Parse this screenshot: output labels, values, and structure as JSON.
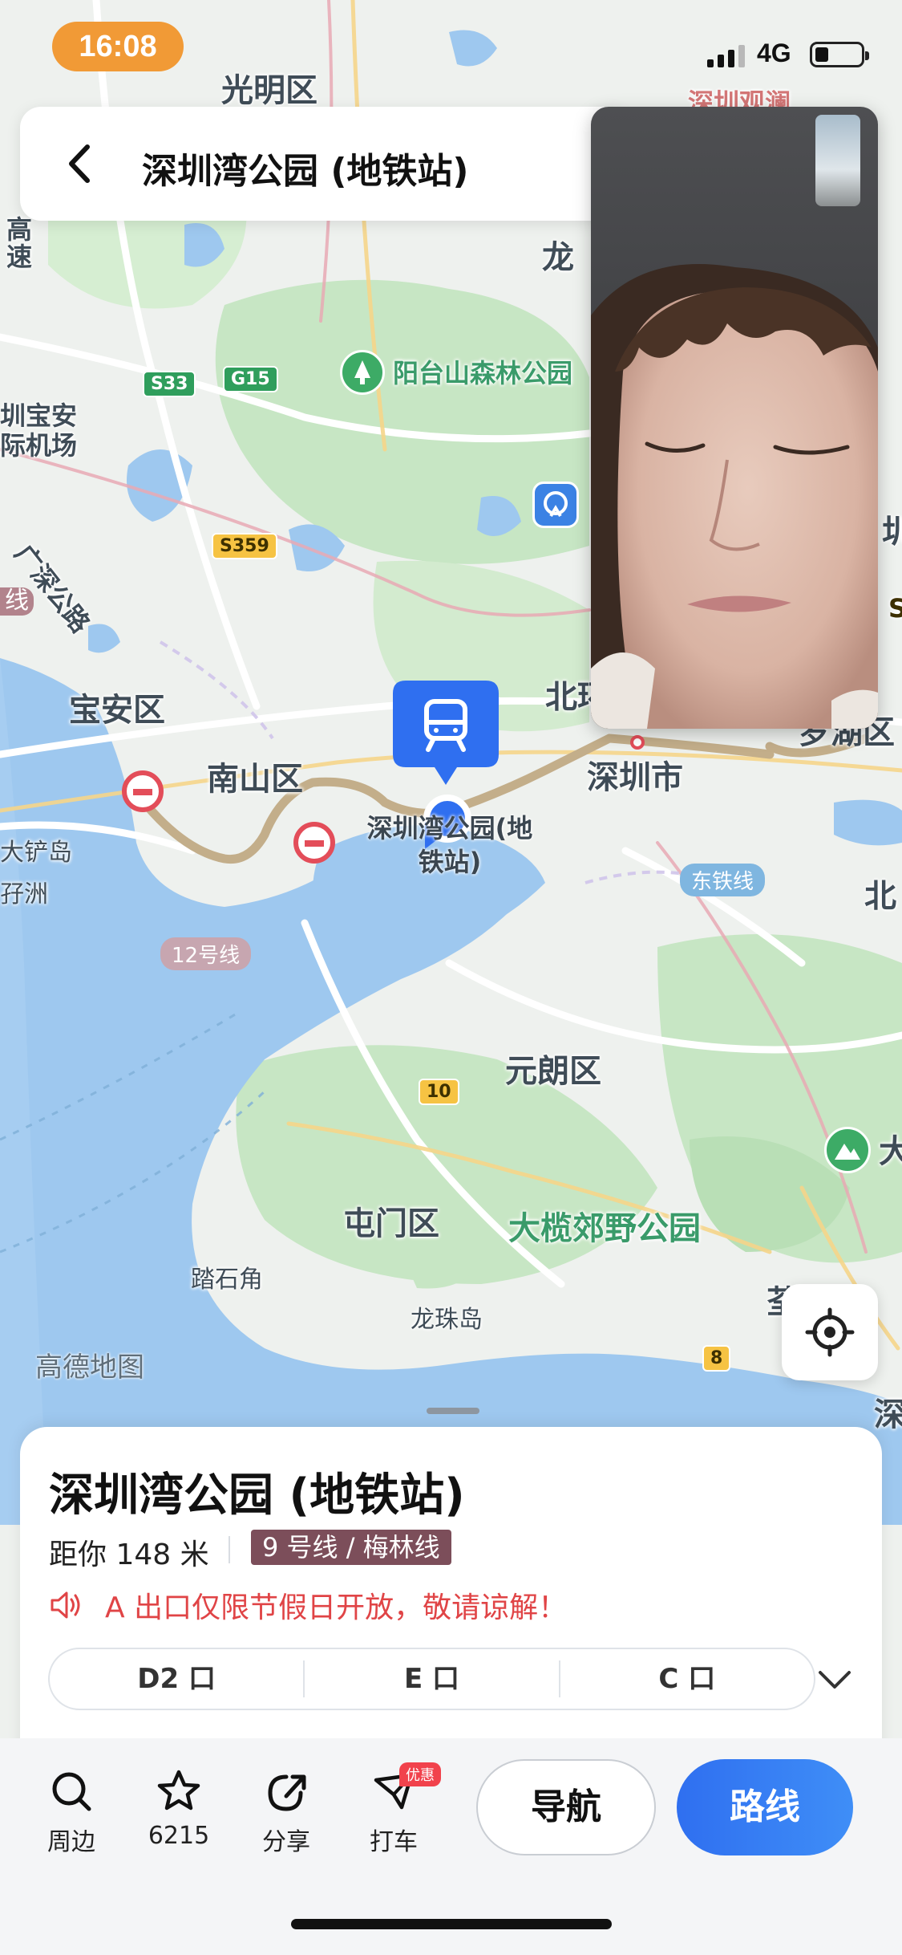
{
  "status_bar": {
    "time": "16:08",
    "network": "4G",
    "battery_level": 0.3
  },
  "header": {
    "title": "深圳湾公园 (地铁站)"
  },
  "map": {
    "labels": {
      "guangming": "光明区",
      "long_partial": "龙",
      "gaosu": "高速",
      "yangtai": "阳台山森林公园",
      "airport": "圳宝安\n际机场",
      "guangshen": "广深公路",
      "xian": "线",
      "baoan": "宝安区",
      "nanshan": "南山区",
      "beihuan": "北环",
      "shenzhen": "深圳市",
      "luohu": "罗湖区",
      "bei": "北",
      "dachan": "大铲岛",
      "haozhou": "孖洲",
      "yuanlang": "元朗区",
      "tunmen": "屯门区",
      "dalan": "大榄郊野公园",
      "tashijiao": "踏石角",
      "longzhu": "龙珠岛",
      "da": "大",
      "quan": "荃",
      "shen": "深",
      "zhen": "圳",
      "s": "S",
      "top_partial": "深圳观澜"
    },
    "shields": {
      "s33": "S33",
      "g15": "G15",
      "s359": "S359",
      "r10": "10",
      "r8": "8"
    },
    "line_tags": {
      "line12": "12号线",
      "dongtie": "东铁线"
    },
    "station_label": "深圳湾公园(地\n铁站)",
    "watermark": "高德地图"
  },
  "poi": {
    "name": "深圳湾公园 (地铁站)",
    "distance": "距你 148 米",
    "lines": "9 号线 / 梅林线",
    "notice": "A 出口仅限节假日开放，敬请谅解！",
    "exits": [
      "D2 口",
      "E 口",
      "C 口"
    ]
  },
  "actions": {
    "nearby": "周边",
    "favorite_count": "6215",
    "share": "分享",
    "taxi": "打车",
    "taxi_badge": "优惠",
    "navigate": "导航",
    "route": "路线"
  },
  "colors": {
    "accent": "#2f6ff0",
    "time_pill": "#f19a36",
    "notice": "#e04446",
    "line_badge": "#7c4e5a",
    "route": "#c3ae8a",
    "water": "#9ec8ef",
    "land": "#eef1ee",
    "park": "#c7e6c4"
  },
  "icons": [
    "chevron-left-icon",
    "train-icon",
    "location-target-icon",
    "search-icon",
    "star-icon",
    "share-icon",
    "taxi-icon",
    "speaker-icon",
    "chevron-down-icon"
  ]
}
